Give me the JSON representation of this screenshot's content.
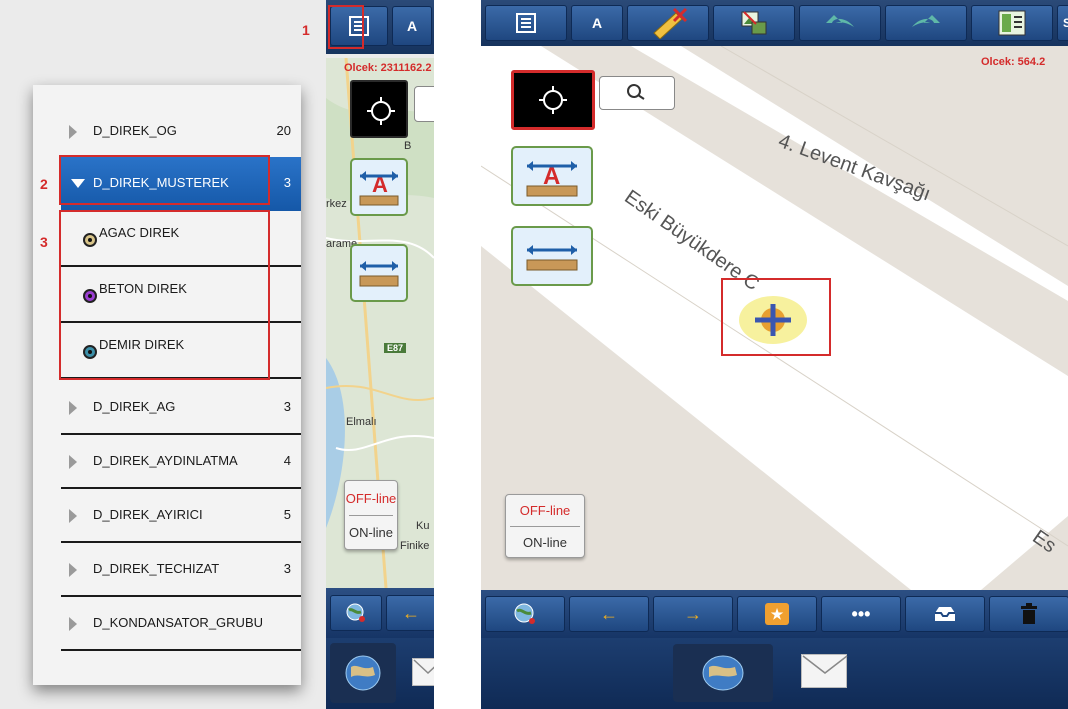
{
  "annotations": [
    "1",
    "2",
    "3"
  ],
  "left": {
    "toolbar": {
      "text_tool_label": "A"
    },
    "scale_text": "Olcek: 2311162.2",
    "map_labels": [
      "B",
      "rkez",
      "arame",
      "E87",
      "Elmalı",
      "Ku",
      "Finike"
    ],
    "line_toggle": {
      "off_label": "OFF-line",
      "on_label": "ON-line"
    },
    "layers": [
      {
        "name": "D_DIREK_OG",
        "count": "20"
      },
      {
        "name": "D_DIREK_MUSTEREK",
        "count": "3",
        "expanded": true
      },
      {
        "name": "D_DIREK_AG",
        "count": "3"
      },
      {
        "name": "D_DIREK_AYDINLATMA",
        "count": "4"
      },
      {
        "name": "D_DIREK_AYIRICI",
        "count": "5"
      },
      {
        "name": "D_DIREK_TECHIZAT",
        "count": "3"
      },
      {
        "name": "D_KONDANSATOR_GRUBU",
        "count": ""
      }
    ],
    "sublayers": [
      {
        "name": "AGAC DIREK",
        "color": "#d8c489"
      },
      {
        "name": "BETON DIREK",
        "color": "#9b3fd1"
      },
      {
        "name": "DEMIR DIREK",
        "color": "#3b8fa8"
      }
    ]
  },
  "right": {
    "toolbar": {
      "text_tool_label": "A",
      "cut_off_label": "S"
    },
    "scale_text": "Olcek: 564.2",
    "street_labels": [
      "4. Levent Kavşağı",
      "Eski Büyükdere C",
      "Es"
    ],
    "line_toggle": {
      "off_label": "OFF-line",
      "on_label": "ON-line"
    }
  },
  "colors": {
    "annotation_red": "#d42b2b",
    "toolbar_blue": "#1f4780",
    "selected_blue": "#1a64b8"
  }
}
